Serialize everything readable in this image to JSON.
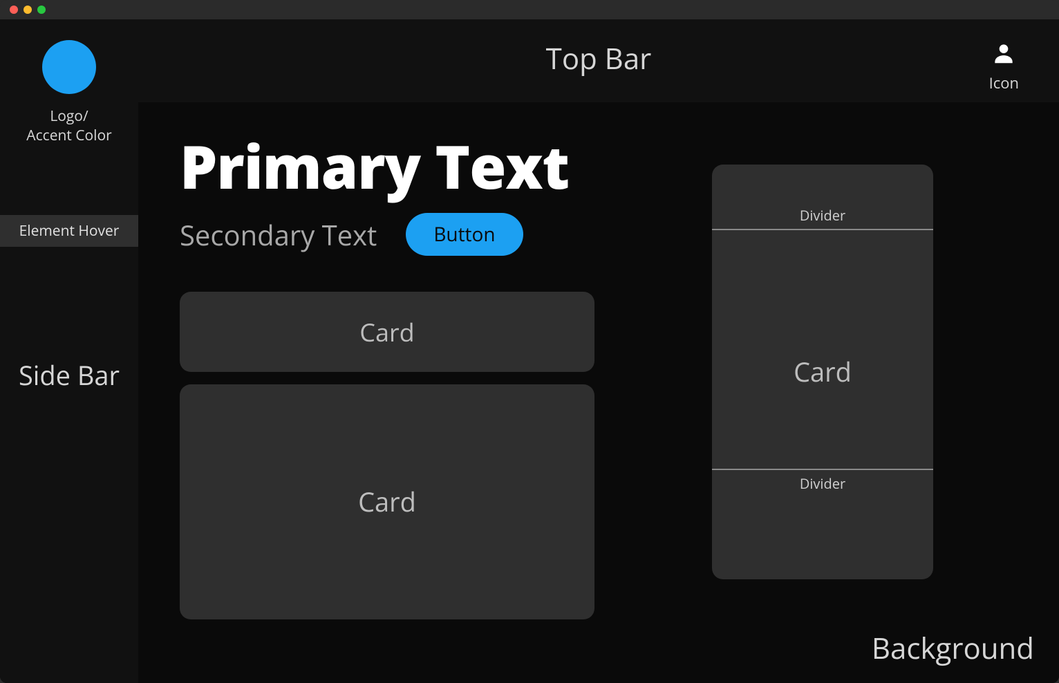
{
  "colors": {
    "accent": "#1ca0f2",
    "background": "#0a0a0a",
    "panel": "#111111",
    "card": "#2f2f2f",
    "primary_text": "#ffffff",
    "secondary_text": "#a8a8a8"
  },
  "sidebar": {
    "logo_label_line1": "Logo/",
    "logo_label_line2": "Accent Color",
    "hover_label": "Element Hover",
    "title": "Side Bar"
  },
  "topbar": {
    "title": "Top Bar",
    "icon_label": "Icon"
  },
  "main": {
    "primary_text": "Primary Text",
    "secondary_text": "Secondary Text",
    "button_label": "Button",
    "card_small_label": "Card",
    "card_medium_label": "Card",
    "card_large_label": "Card",
    "divider_top_label": "Divider",
    "divider_bottom_label": "Divider",
    "background_label": "Background"
  }
}
